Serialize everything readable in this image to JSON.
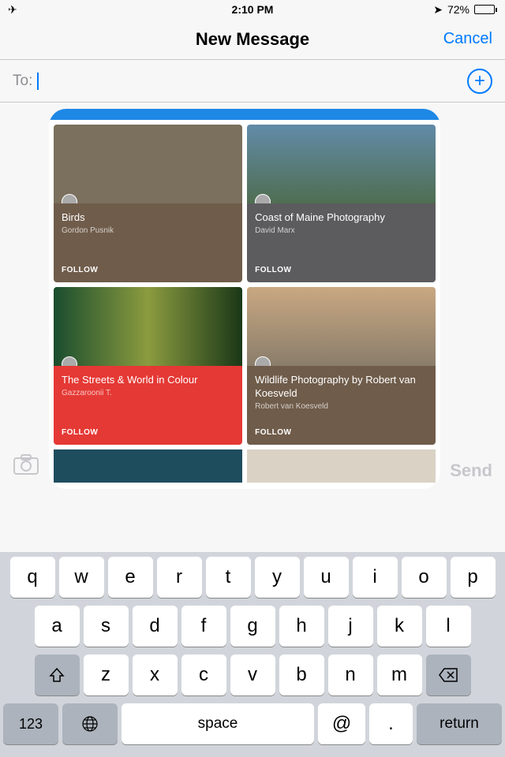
{
  "status": {
    "time": "2:10 PM",
    "battery": "72%"
  },
  "nav": {
    "title": "New Message",
    "cancel": "Cancel"
  },
  "to": {
    "label": "To:",
    "placeholder": ""
  },
  "send": "Send",
  "cards": [
    {
      "title": "Birds",
      "author": "Gordon Pusnik",
      "follow": "FOLLOW"
    },
    {
      "title": "Coast of Maine Photography",
      "author": "David Marx",
      "follow": "FOLLOW"
    },
    {
      "title": "The Streets & World in Colour",
      "author": "Gazzaroonii T.",
      "follow": "FOLLOW"
    },
    {
      "title": "Wildlife Photography by Robert van Koesveld",
      "author": "Robert van Koesveld",
      "follow": "FOLLOW"
    }
  ],
  "keys": {
    "r1": [
      "q",
      "w",
      "e",
      "r",
      "t",
      "y",
      "u",
      "i",
      "o",
      "p"
    ],
    "r2": [
      "a",
      "s",
      "d",
      "f",
      "g",
      "h",
      "j",
      "k",
      "l"
    ],
    "r3": [
      "z",
      "x",
      "c",
      "v",
      "b",
      "n",
      "m"
    ],
    "num": "123",
    "space": "space",
    "at": "@",
    "dot": ".",
    "ret": "return"
  }
}
